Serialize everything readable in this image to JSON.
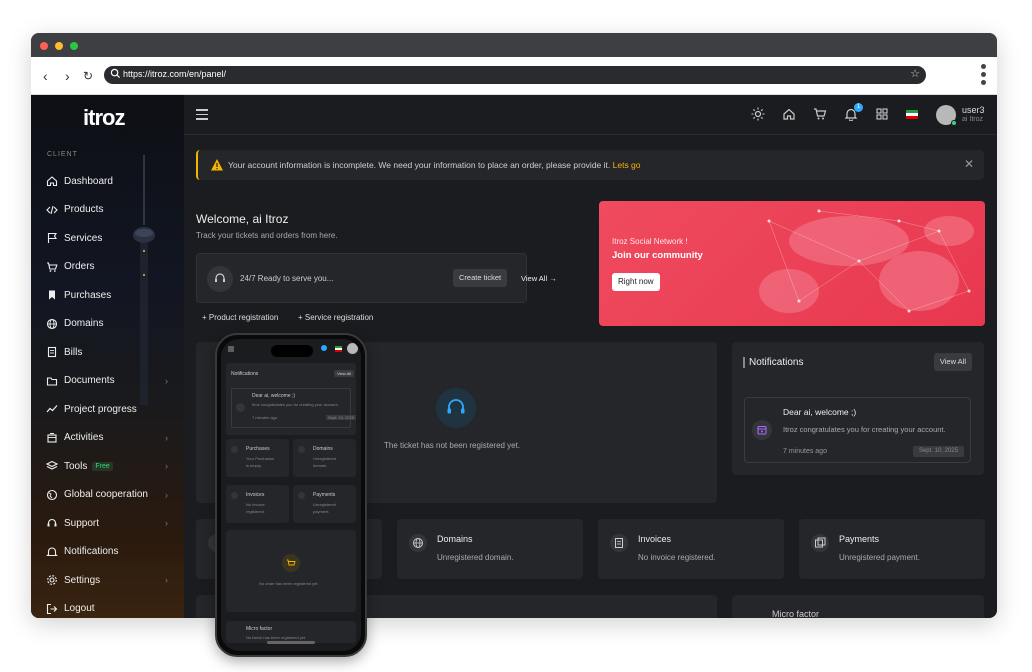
{
  "browser": {
    "url": "https://itroz.com/en/panel/"
  },
  "sidebar": {
    "logo": "itroz",
    "section_label": "CLIENT",
    "items": [
      {
        "label": "Dashboard",
        "icon": "home-icon",
        "chevron": false
      },
      {
        "label": "Products",
        "icon": "code-icon",
        "chevron": false
      },
      {
        "label": "Services",
        "icon": "flag-icon",
        "chevron": false
      },
      {
        "label": "Orders",
        "icon": "cart-icon",
        "chevron": false
      },
      {
        "label": "Purchases",
        "icon": "bookmark-icon",
        "chevron": false
      },
      {
        "label": "Domains",
        "icon": "globe-icon",
        "chevron": false
      },
      {
        "label": "Bills",
        "icon": "receipt-icon",
        "chevron": false
      },
      {
        "label": "Documents",
        "icon": "folder-icon",
        "chevron": true
      },
      {
        "label": "Project progress",
        "icon": "chart-line-icon",
        "chevron": false
      },
      {
        "label": "Activities",
        "icon": "activities-icon",
        "chevron": true
      },
      {
        "label": "Tools",
        "icon": "layers-icon",
        "chevron": true,
        "badge": "Free"
      },
      {
        "label": "Global cooperation",
        "icon": "globe-cooperation-icon",
        "chevron": true
      },
      {
        "label": "Support",
        "icon": "headset-icon",
        "chevron": true
      },
      {
        "label": "Notifications",
        "icon": "bell-icon",
        "chevron": false
      },
      {
        "label": "Settings",
        "icon": "gear-icon",
        "chevron": true
      },
      {
        "label": "Logout",
        "icon": "logout-icon",
        "chevron": false
      }
    ]
  },
  "topbar": {
    "notification_count": "1",
    "user_name": "user3",
    "user_sub": "ai Itroz"
  },
  "alert": {
    "text": "Your account information is incomplete. We need your information to place an order, please provide it.",
    "link": "Lets go"
  },
  "welcome": {
    "title": "Welcome, ai Itroz",
    "subtitle": "Track your tickets and orders from here."
  },
  "support": {
    "text": "24/7 Ready to serve you...",
    "create_ticket": "Create ticket",
    "view_all": "View All"
  },
  "registration": {
    "product": "Product registration",
    "service": "Service registration"
  },
  "banner": {
    "title": "Itroz Social Network !",
    "heading": "Join our community",
    "button": "Right now"
  },
  "tickets": {
    "empty": "The ticket has not been registered yet."
  },
  "notifications": {
    "title": "Notifications",
    "view_all": "View All",
    "items": [
      {
        "title": "Dear ai, welcome ;)",
        "body": "Itroz congratulates you for creating your account.",
        "time": "7 minutes ago",
        "date": "Sept. 10, 2025"
      }
    ]
  },
  "stats": [
    {
      "title": "Domains",
      "subtitle": "Unregistered domain.",
      "icon": "globe-icon"
    },
    {
      "title": "Invoices",
      "subtitle": "No invoice registered.",
      "icon": "invoice-icon"
    },
    {
      "title": "Payments",
      "subtitle": "Unregistered payment.",
      "icon": "payment-icon"
    }
  ],
  "micro_factor": {
    "title": "Micro factor"
  },
  "phone": {
    "notifications_title": "Notifications",
    "view_all": "View All",
    "notif_title": "Dear ai, welcome ;)",
    "notif_body": "Itroz congratulates you for creating your account.",
    "notif_time": "7 minutes ago",
    "notif_date": "Sept. 10, 2025",
    "cards": [
      {
        "title": "Purchases",
        "sub1": "Your Purchases",
        "sub2": "is empty."
      },
      {
        "title": "Domains",
        "sub1": "Unregistered",
        "sub2": "domain."
      },
      {
        "title": "Invoices",
        "sub1": "No invoice",
        "sub2": "registered."
      },
      {
        "title": "Payments",
        "sub1": "Unregistered",
        "sub2": "payment."
      }
    ],
    "order_empty": "No order has been registered yet.",
    "micro_title": "Micro factor",
    "micro_sub": "No factor has been registered yet."
  },
  "colors": {
    "accent": "#f5b400",
    "banner": "#e8384f",
    "badge": "#2ea8ff",
    "success": "#3cd67a"
  }
}
